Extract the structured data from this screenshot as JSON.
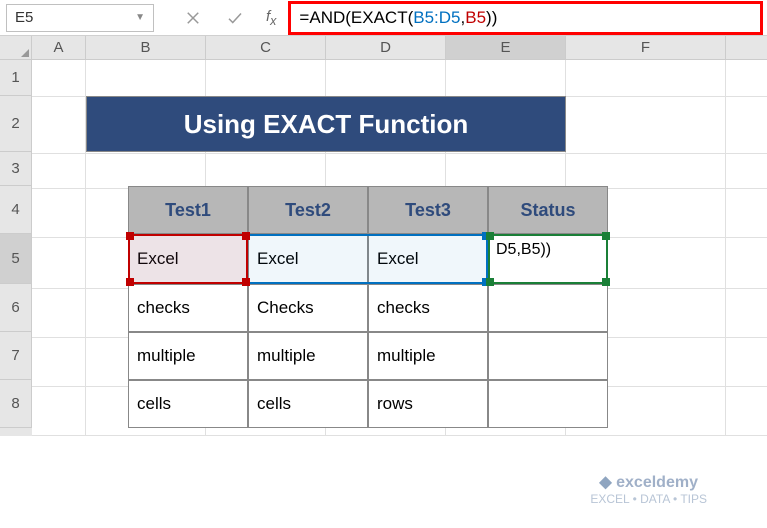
{
  "nameBox": {
    "value": "E5"
  },
  "formulaBar": {
    "prefix": "=AND(EXACT(",
    "ref1": "B5:D5",
    "comma": ",",
    "ref2": "B5",
    "suffix": "))"
  },
  "columns": [
    "A",
    "B",
    "C",
    "D",
    "E",
    "F"
  ],
  "rows": [
    "1",
    "2",
    "3",
    "4",
    "5",
    "6",
    "7",
    "8"
  ],
  "title": "Using EXACT Function",
  "table": {
    "headers": [
      "Test1",
      "Test2",
      "Test3",
      "Status"
    ],
    "rows": [
      [
        "Excel",
        "Excel",
        "Excel",
        "D5,B5))"
      ],
      [
        "checks",
        "Checks",
        "checks",
        ""
      ],
      [
        "multiple",
        "multiple",
        "multiple",
        ""
      ],
      [
        "cells",
        "cells",
        "rows",
        ""
      ]
    ]
  },
  "chart_data": {
    "type": "table",
    "title": "Using EXACT Function",
    "headers": [
      "Test1",
      "Test2",
      "Test3",
      "Status"
    ],
    "rows": [
      [
        "Excel",
        "Excel",
        "Excel",
        "=AND(EXACT(B5:D5,B5))"
      ],
      [
        "checks",
        "Checks",
        "checks",
        ""
      ],
      [
        "multiple",
        "multiple",
        "multiple",
        ""
      ],
      [
        "cells",
        "cells",
        "rows",
        ""
      ]
    ],
    "active_cell": "E5",
    "formula": "=AND(EXACT(B5:D5,B5))"
  },
  "watermark": {
    "brand": "exceldemy",
    "tagline": "EXCEL • DATA • TIPS"
  }
}
